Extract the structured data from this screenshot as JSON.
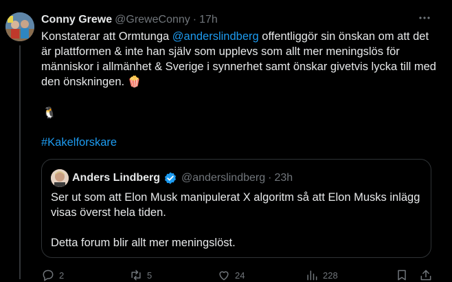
{
  "tweet": {
    "author_name": "Conny Grewe",
    "author_handle": "@GreweConny",
    "separator": "·",
    "time": "17h",
    "text_before_mention": "Konstaterar att Ormtunga ",
    "mention": "@anderslindberg",
    "text_after_mention": "  offentliggör sin önskan om att det är plattformen & inte han själv som upplevs som allt mer meningslös för människor i allmänhet & Sverige i synnerhet samt önskar givetvis lycka till med den önskningen. ",
    "emoji_popcorn": "🍿",
    "emoji_penguin": "🐧",
    "hashtag": "#Kakelforskare"
  },
  "quoted_tweet": {
    "author_name": "Anders Lindberg",
    "author_handle": "@anderslindberg",
    "separator": "·",
    "time": "23h",
    "text_line_1": "Ser ut som att Elon Musk manipulerat X algoritm så att Elon Musks inlägg visas överst hela tiden.",
    "text_line_2": "Detta forum blir allt mer meningslöst."
  },
  "actions": {
    "replies": "2",
    "reposts": "5",
    "likes": "24",
    "views": "228"
  },
  "icons": {
    "more": "more-dots-icon",
    "verified": "verified-badge-icon",
    "reply": "reply-icon",
    "repost": "repost-icon",
    "like": "heart-icon",
    "views": "views-chart-icon",
    "bookmark": "bookmark-icon",
    "share": "share-icon"
  },
  "colors": {
    "background": "#000000",
    "text": "#e7e9ea",
    "muted": "#71767b",
    "link": "#1d9bf0",
    "border": "#2f3336"
  }
}
